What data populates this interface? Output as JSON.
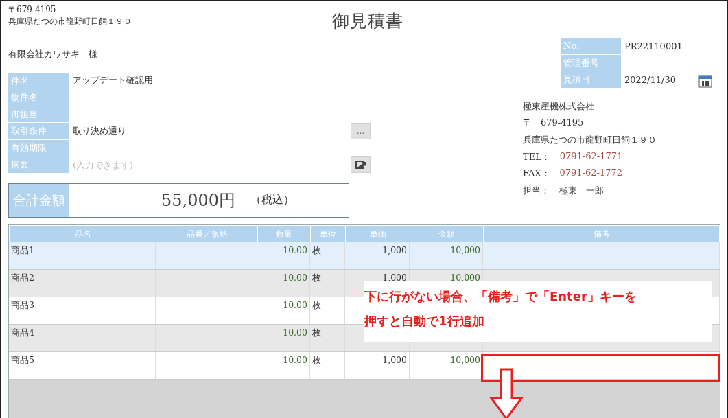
{
  "sender": {
    "postal": "〒679-4195",
    "address": "兵庫県たつの市龍野町日飼１９０"
  },
  "title": "御見積書",
  "customer": "有限会社カワサキ　様",
  "fields": [
    {
      "kind": "text",
      "label": "件名",
      "value": "アップデート確認用"
    },
    {
      "kind": "text",
      "label": "物件名"
    },
    {
      "kind": "text",
      "label": "御担当"
    },
    {
      "kind": "picker",
      "label": "取引条件",
      "value": "取り決め通り",
      "button": "…"
    },
    {
      "kind": "text",
      "label": "有効期限"
    },
    {
      "kind": "memo",
      "label": "摘要",
      "placeholder": "(入力できます)"
    }
  ],
  "total": {
    "label": "合計金額",
    "amount": "55,000円",
    "note": "（税込）"
  },
  "meta": [
    {
      "kind": "text",
      "label": "No.",
      "value": "PR22110001"
    },
    {
      "kind": "text",
      "label": "管理番号"
    },
    {
      "kind": "date",
      "label": "見積日",
      "value": "2022/11/30"
    }
  ],
  "company": {
    "name": "極東産機株式会社",
    "postal": "〒　679-4195",
    "address": "兵庫県たつの市龍野町日飼１９０",
    "contacts": [
      {
        "label": "TEL：",
        "value": "0791-62-1771",
        "color": "#a0524a"
      },
      {
        "label": "FAX：",
        "value": "0791-62-1772",
        "color": "#a0524a"
      },
      {
        "label": "担当：",
        "value": "極東　一郎",
        "color": "#444444"
      }
    ]
  },
  "table": {
    "columns": [
      "品名",
      "品番／規格",
      "数量",
      "単位",
      "単価",
      "金額",
      "備考"
    ],
    "rows": [
      {
        "name": "商品1",
        "qty": "10.00",
        "unit": "枚",
        "price": "1,000",
        "amount": "10,000",
        "selected": true
      },
      {
        "name": "商品2",
        "qty": "10.00",
        "unit": "枚",
        "price": "1,000",
        "amount": "10,000",
        "selected": false
      },
      {
        "name": "商品3",
        "qty": "10.00",
        "unit": "枚",
        "selected": false
      },
      {
        "name": "商品4",
        "qty": "10.00",
        "unit": "枚",
        "selected": false
      },
      {
        "name": "商品5",
        "qty": "10.00",
        "unit": "枚",
        "price": "1,000",
        "amount": "10,000",
        "selected": false
      }
    ]
  },
  "callout": {
    "lines": [
      "下に行がない場合、「備考」で「Enter」キーを",
      "押すと自動で1行追加"
    ]
  }
}
